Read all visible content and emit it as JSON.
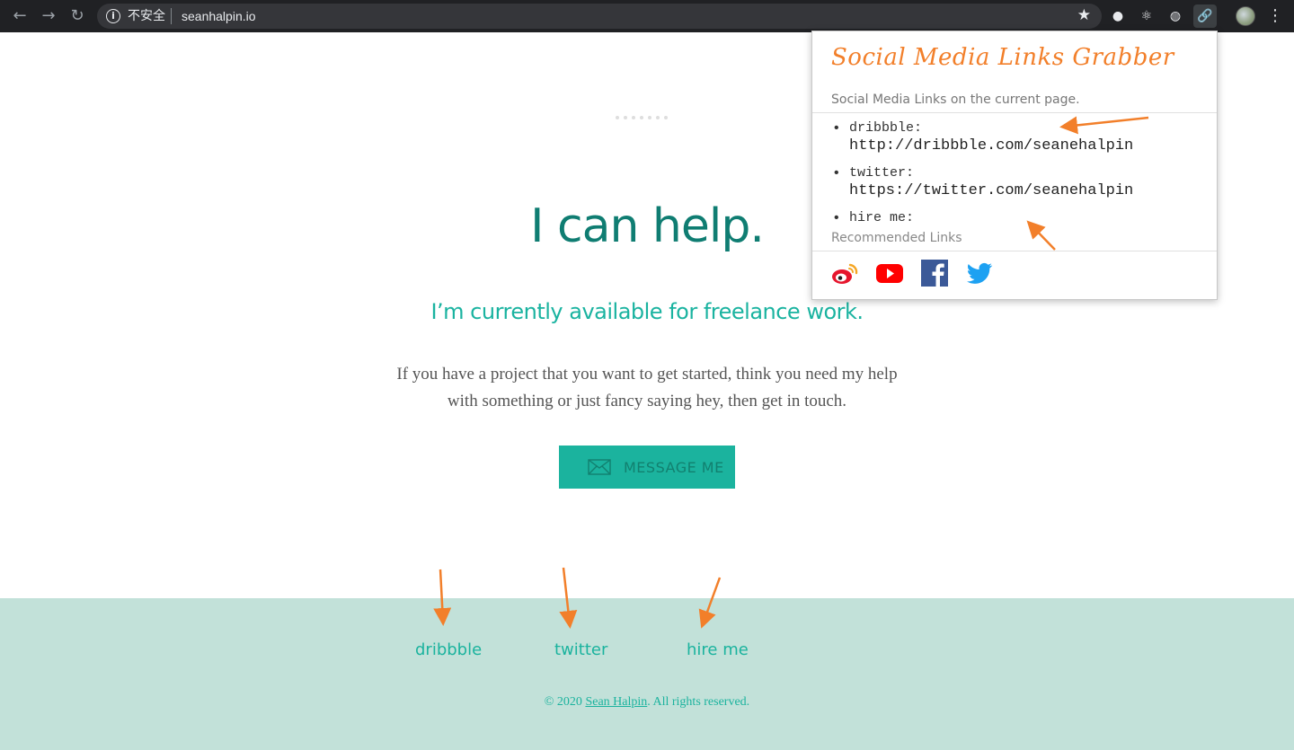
{
  "browser": {
    "insecure_label": "不安全",
    "url": "seanhalpin.io"
  },
  "page": {
    "headline": "I can help.",
    "subheadline": "I’m currently available for freelance work.",
    "body_line1": "If you have a project that you want to get started, think you need my help",
    "body_line2": "with something or just fancy saying hey, then get in touch.",
    "message_button": "MESSAGE ME",
    "footer_links": [
      "dribbble",
      "twitter",
      "hire me"
    ],
    "copyright_prefix": "© 2020 ",
    "copyright_name": "Sean Halpin",
    "copyright_suffix": ". All rights reserved."
  },
  "popup": {
    "title": "Social Media Links Grabber",
    "subtitle": "Social Media Links on the current page.",
    "links": [
      {
        "name": "dribbble:",
        "url": "http://dribbble.com/seanehalpin"
      },
      {
        "name": "twitter:",
        "url": "https://twitter.com/seanehalpin"
      },
      {
        "name": "hire me:",
        "url": ""
      }
    ],
    "recommended_label": "Recommended Links",
    "recommended_icons": [
      "weibo-icon",
      "youtube-icon",
      "facebook-icon",
      "twitter-icon"
    ]
  },
  "colors": {
    "accent": "#1bb39e",
    "headline": "#0f7d72",
    "footer_bg": "#c2e1d9",
    "popup_title": "#f27f2a",
    "arrow": "#f27f2a"
  }
}
